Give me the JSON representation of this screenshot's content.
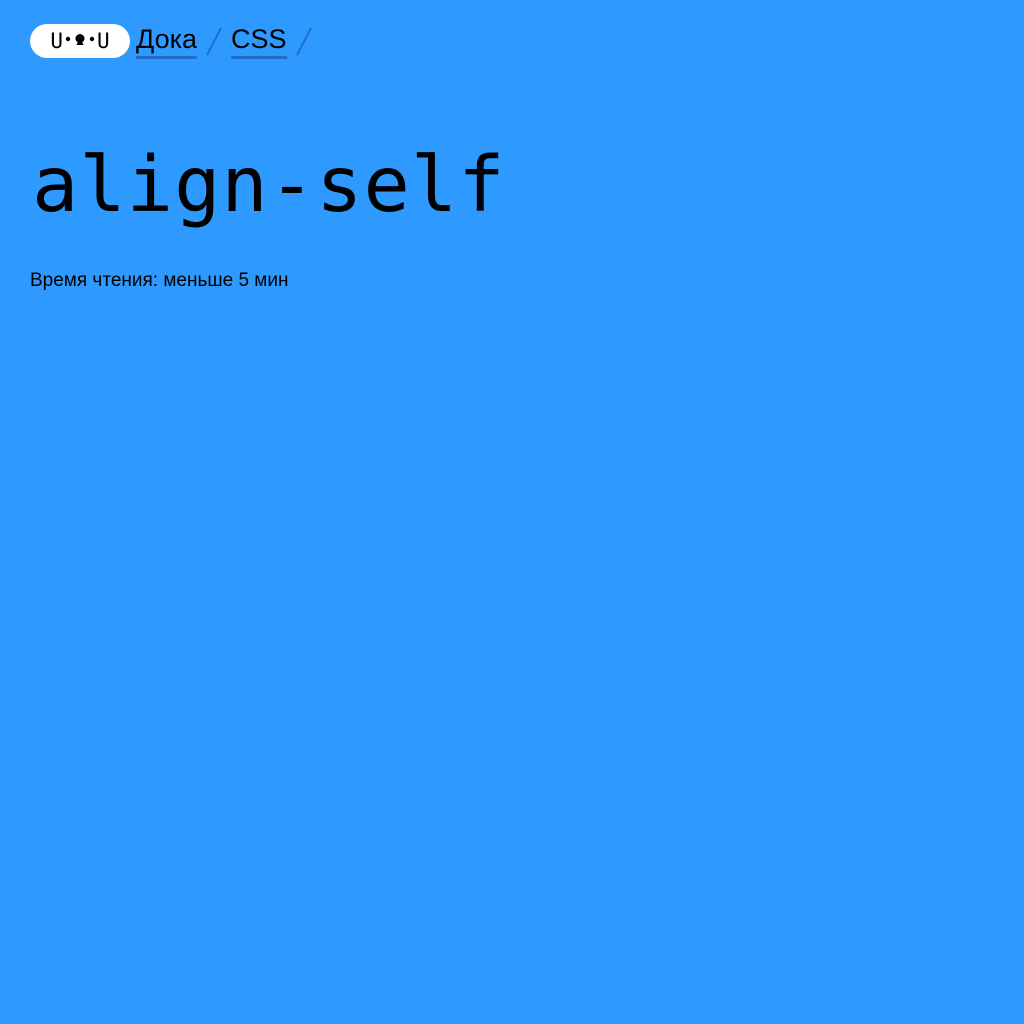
{
  "header": {
    "logo": {
      "left": "U",
      "right": "U",
      "icon": "doka-face-logo-icon"
    },
    "breadcrumbs": [
      {
        "label": "Дока"
      },
      {
        "label": "CSS"
      }
    ]
  },
  "article": {
    "title": "align-self",
    "reading_time": "Время чтения: меньше 5 мин"
  },
  "colors": {
    "background": "#2e9aff",
    "text": "#000000",
    "logo_bg": "#ffffff",
    "link_underline": "#1f6fc9"
  }
}
